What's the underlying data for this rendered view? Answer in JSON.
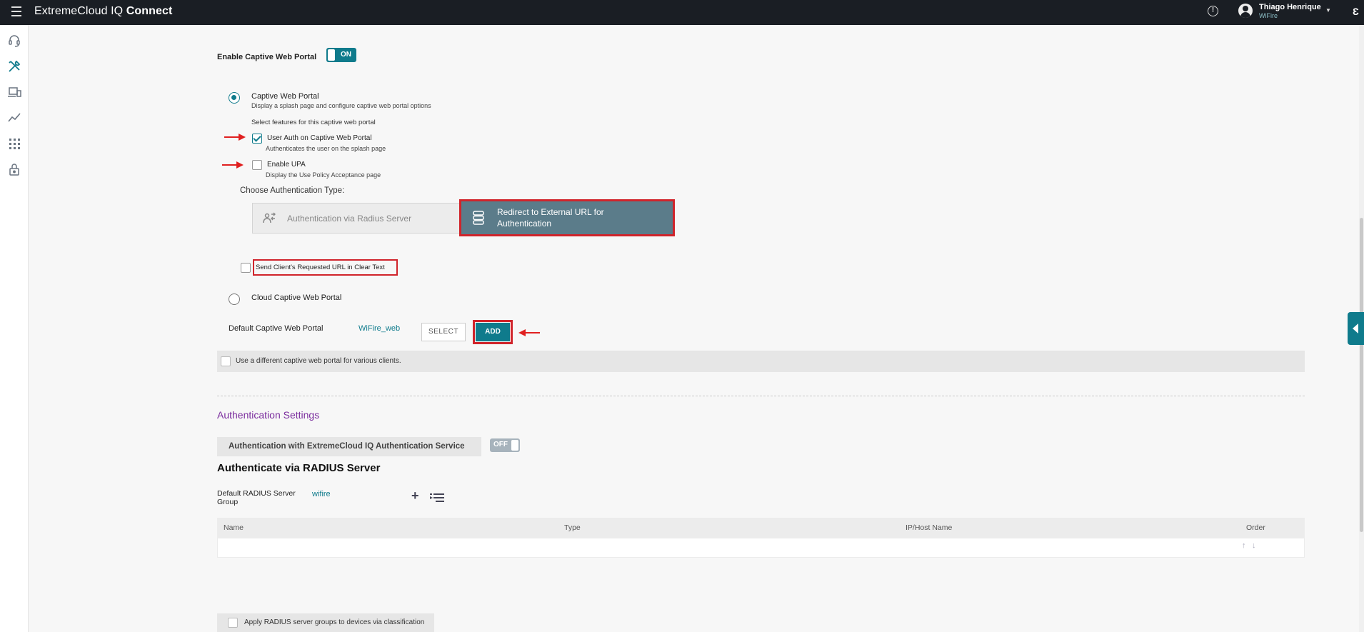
{
  "app": {
    "title_regular": "ExtremeCloud IQ ",
    "title_bold": "Connect",
    "help_icon": "info-circle-icon",
    "user": {
      "name": "Thiago Henrique",
      "org": "WiFire"
    }
  },
  "sidebar": {
    "items": [
      {
        "icon": "headset-icon"
      },
      {
        "icon": "configure-tools-icon"
      },
      {
        "icon": "devices-icon"
      },
      {
        "icon": "analytics-icon"
      },
      {
        "icon": "apps-grid-icon"
      },
      {
        "icon": "lock-icon"
      }
    ]
  },
  "portal": {
    "enable_label": "Enable Captive Web Portal",
    "enable_state": "ON",
    "cwp_title": "Captive Web Portal",
    "cwp_desc": "Display a splash page and configure captive web portal options",
    "features_label": "Select features for this captive web portal",
    "user_auth_label": "User Auth on Captive Web Portal",
    "user_auth_desc": "Authenticates the user on the splash page",
    "upa_label": "Enable UPA",
    "upa_desc": "Display the Use Policy Acceptance page",
    "auth_type_label": "Choose Authentication Type:",
    "auth_radius_label": "Authentication via Radius Server",
    "auth_redirect_label": "Redirect to External URL for Authentication",
    "send_url_label": "Send Client's Requested URL in Clear Text",
    "cloud_cwp_label": "Cloud Captive Web Portal",
    "default_cwp_label": "Default Captive Web Portal",
    "default_cwp_value": "WiFire_web",
    "select_button": "SELECT",
    "add_button": "ADD",
    "different_portal_label": "Use a different captive web portal for various clients."
  },
  "auth_settings": {
    "section_title": "Authentication Settings",
    "service_label": "Authentication with ExtremeCloud IQ Authentication Service",
    "service_state": "OFF",
    "radius_title": "Authenticate via RADIUS Server",
    "radius_group_label": "Default RADIUS Server Group",
    "radius_group_value": "wifire",
    "table_columns": [
      "Name",
      "Type",
      "IP/Host Name",
      "Order"
    ],
    "apply_label": "Apply RADIUS server groups to devices via classification"
  },
  "colors": {
    "accent": "#0f7b8c",
    "annotation_red": "#d0242b",
    "topbar": "#1a1e24",
    "section_title": "#7b2d9e"
  }
}
